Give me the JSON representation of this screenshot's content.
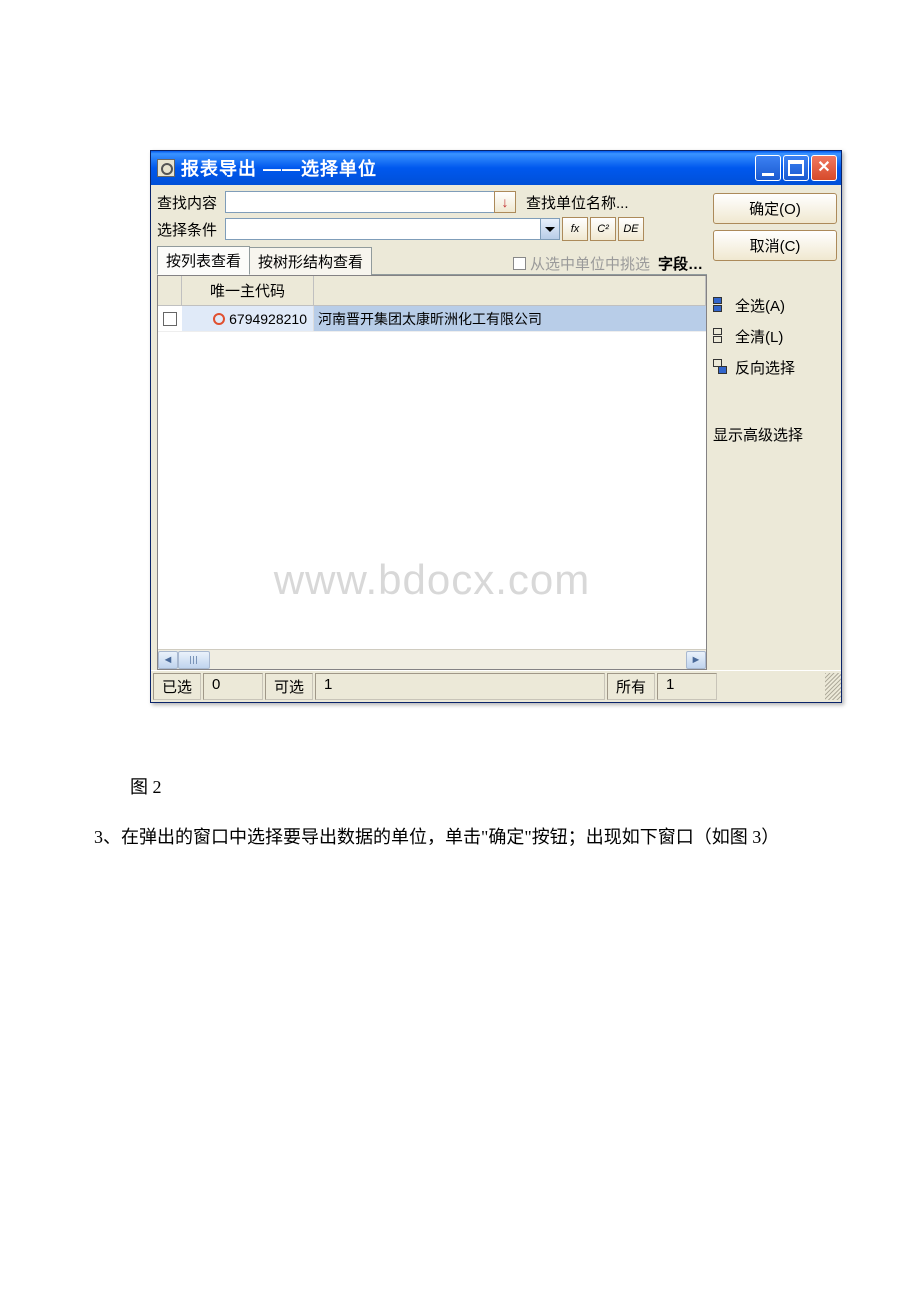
{
  "titlebar": {
    "title": "报表导出 ——选择单位"
  },
  "search": {
    "content_label": "查找内容",
    "search_name_label": "查找单位名称...",
    "condition_label": "选择条件",
    "fx_label": "fx",
    "c2_label": "C²",
    "de_label": "DE"
  },
  "tabs": {
    "list_view": "按列表查看",
    "tree_view": "按树形结构查看",
    "from_selected_label": "从选中单位中挑选",
    "fields_label": "字段…"
  },
  "grid": {
    "header_code": "唯一主代码",
    "rows": [
      {
        "code": "6794928210",
        "name": "河南晋开集团太康昕洲化工有限公司"
      }
    ]
  },
  "watermark": "www.bdocx.com",
  "statusbar": {
    "selected_label": "已选",
    "selected_value": "0",
    "available_label": "可选",
    "available_value": "1",
    "all_label": "所有",
    "all_value": "1"
  },
  "buttons": {
    "ok": "确定(O)",
    "cancel": "取消(C)",
    "select_all": "全选(A)",
    "clear_all": "全清(L)",
    "invert": "反向选择",
    "advanced": "显示高级选择"
  },
  "caption": "图 2",
  "body": "3、在弹出的窗口中选择要导出数据的单位，单击\"确定\"按钮；出现如下窗口（如图 3）"
}
